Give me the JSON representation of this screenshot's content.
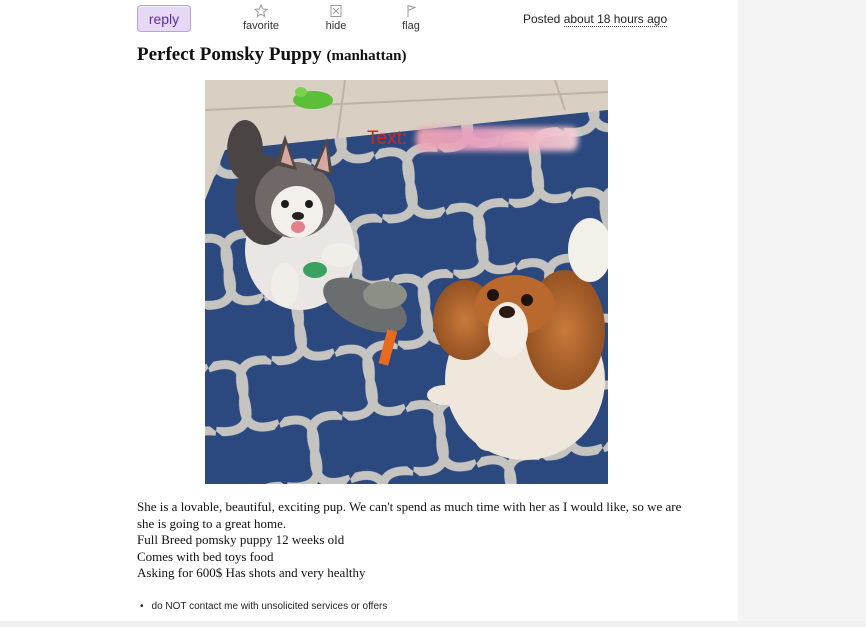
{
  "actions": {
    "reply_label": "reply",
    "favorite_label": "favorite",
    "hide_label": "hide",
    "flag_label": "flag"
  },
  "posted": {
    "prefix": "Posted",
    "relative": "about 18 hours ago"
  },
  "listing": {
    "title": "Perfect Pomsky Puppy",
    "location": "(manhattan)"
  },
  "photo": {
    "overlay_text": "Text:"
  },
  "description": [
    "She is a lovable, beautiful, exciting pup. We can't spend as much time with her as I would like, so we are",
    "she is going to a great home.",
    "Full Breed pomsky puppy 12 weeks old",
    "Comes with bed toys food",
    "Asking for 600$ Has shots and very healthy"
  ],
  "notices": [
    "do NOT contact me with unsolicited services or offers"
  ],
  "colors": {
    "reply_bg": "#e6d9f5",
    "reply_text": "#5d2ea0",
    "overlay_text": "#d0242b"
  }
}
